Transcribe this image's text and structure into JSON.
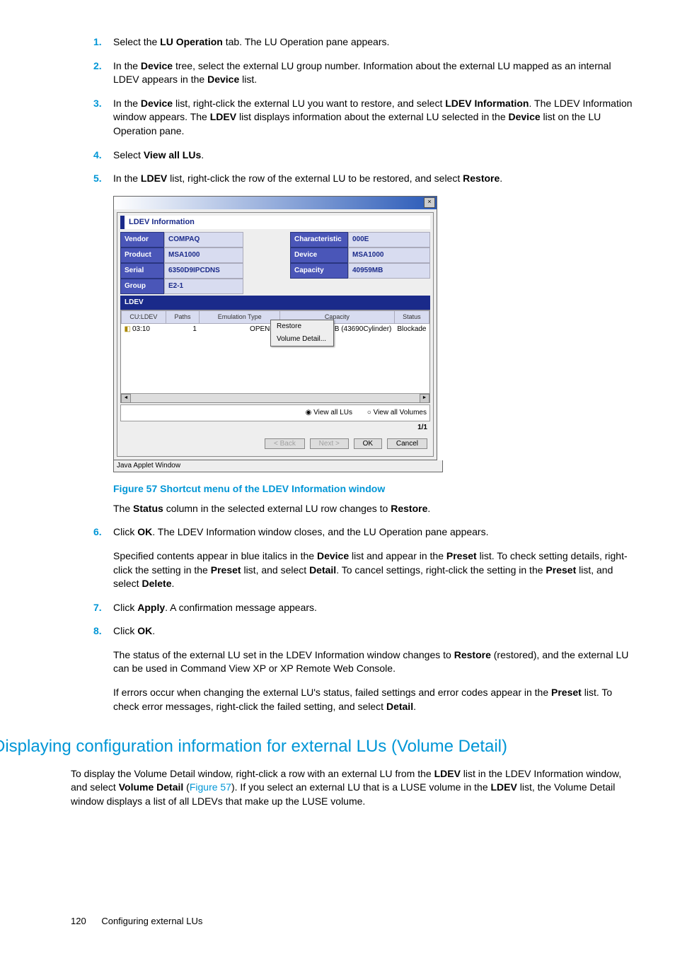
{
  "steps": {
    "s1": {
      "num": "1.",
      "a": "Select the ",
      "b": "LU Operation",
      "c": " tab. The LU Operation pane appears."
    },
    "s2": {
      "num": "2.",
      "a": "In the ",
      "b": "Device",
      "c": " tree, select the external LU group number. Information about the external LU mapped as an internal LDEV appears in the ",
      "d": "Device",
      "e": " list."
    },
    "s3": {
      "num": "3.",
      "a": "In the ",
      "b": "Device",
      "c": " list, right-click the external LU you want to restore, and select ",
      "d": "LDEV Information",
      "e": ". The LDEV Information window appears. The ",
      "f": "LDEV",
      "g": " list displays information about the external LU selected in the ",
      "h": "Device",
      "i": " list on the LU Operation pane."
    },
    "s4": {
      "num": "4.",
      "a": "Select ",
      "b": "View all LUs",
      "c": "."
    },
    "s5": {
      "num": "5.",
      "a": "In the ",
      "b": "LDEV",
      "c": " list, right-click the row of the external LU to be restored, and select ",
      "d": "Restore",
      "e": "."
    },
    "s5_caption": "Figure 57 Shortcut menu of the LDEV Information window",
    "s5_after": {
      "a": "The ",
      "b": "Status",
      "c": " column in the selected external LU row changes to ",
      "d": "Restore",
      "e": "."
    },
    "s6": {
      "num": "6.",
      "a": "Click ",
      "b": "OK",
      "c": ". The LDEV Information window closes, and the LU Operation pane appears."
    },
    "s6_p": {
      "a": "Specified contents appear in blue italics in the ",
      "b": "Device",
      "c": " list and appear in the ",
      "d": "Preset",
      "e": " list. To check setting details, right-click the setting in the ",
      "f": "Preset",
      "g": " list, and select ",
      "h": "Detail",
      "i": ". To cancel settings, right-click the setting in the ",
      "j": "Preset",
      "k": " list, and select ",
      "l": "Delete",
      "m": "."
    },
    "s7": {
      "num": "7.",
      "a": "Click ",
      "b": "Apply",
      "c": ". A confirmation message appears."
    },
    "s8": {
      "num": "8.",
      "a": "Click ",
      "b": "OK",
      "c": "."
    },
    "s8_p1": {
      "a": "The status of the external LU set in the LDEV Information window changes to ",
      "b": "Restore",
      "c": " (restored), and the external LU can be used in Command View XP or XP Remote Web Console."
    },
    "s8_p2": {
      "a": "If errors occur when changing the external LU's status, failed settings and error codes appear in the ",
      "b": "Preset",
      "c": " list. To check error messages, right-click the failed setting, and select ",
      "d": "Detail",
      "e": "."
    }
  },
  "section_h": "Displaying configuration information for external LUs (Volume Detail)",
  "section_p": {
    "a": "To display the Volume Detail window, right-click a row with an external LU from the ",
    "b": "LDEV",
    "c": " list in the LDEV Information window, and select ",
    "d": "Volume Detail",
    "e": " (",
    "f": "Figure 57",
    "g": "). If you select an external LU that is a LUSE volume in the ",
    "h": "LDEV",
    "i": " list, the Volume Detail window displays a list of all LDEVs that make up the LUSE volume."
  },
  "dlg": {
    "close": "×",
    "title": "LDEV Information",
    "labels": {
      "vendor": "Vendor",
      "product": "Product",
      "serial": "Serial",
      "group": "Group",
      "characteristic": "Characteristic",
      "device": "Device",
      "capacity": "Capacity"
    },
    "vals": {
      "vendor": "COMPAQ",
      "product": "MSA1000",
      "serial": "6350D9IPCDNS",
      "group": "E2-1",
      "characteristic": "000E",
      "device": "MSA1000",
      "capacity": "40959MB"
    },
    "ldev_hdr": "LDEV",
    "cols": {
      "cu": "CU:LDEV",
      "paths": "Paths",
      "emu": "Emulation Type",
      "cap": "Capacity",
      "status": "Status"
    },
    "row": {
      "cu": "03:10",
      "paths": "1",
      "emu": "OPEN-V",
      "cap": "40959MB (43690Cylinder)",
      "status": "Blockade"
    },
    "menu": {
      "restore": "Restore",
      "detail": "Volume Detail..."
    },
    "radio1": "View all LUs",
    "radio2": "View all Volumes",
    "count": "1/1",
    "buttons": {
      "back": "< Back",
      "next": "Next >",
      "ok": "OK",
      "cancel": "Cancel"
    },
    "java": "Java Applet Window"
  },
  "footer": {
    "page": "120",
    "title": "Configuring external LUs"
  }
}
